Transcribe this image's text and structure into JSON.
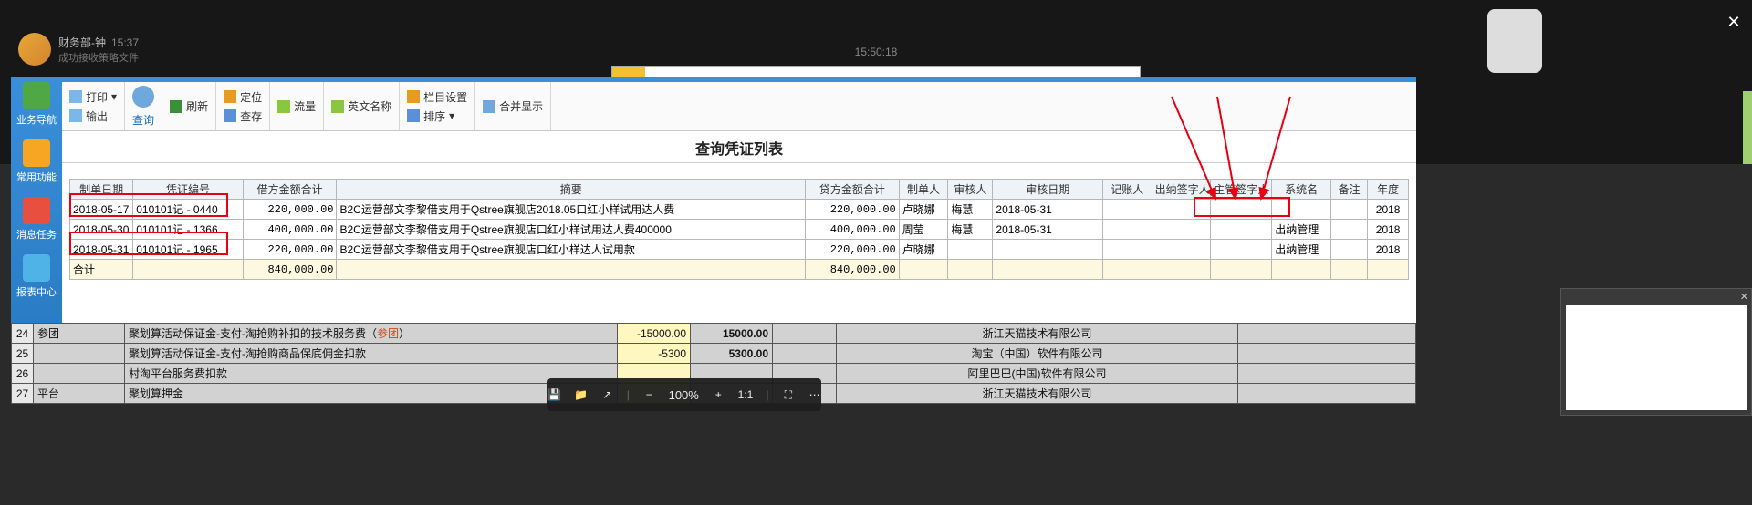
{
  "chat": {
    "name": "财务部-钟",
    "time": "15:37",
    "sub": "成功接收策略文件"
  },
  "clock": "15:50:18",
  "close": "✕",
  "rail": [
    {
      "label": "业务导航"
    },
    {
      "label": "常用功能"
    },
    {
      "label": "消息任务"
    },
    {
      "label": "报表中心"
    }
  ],
  "ribbon": {
    "print": "打印",
    "export": "输出",
    "query": "查询",
    "refresh": "刷新",
    "locate": "定位",
    "savequery": "查存",
    "flow": "流量",
    "english": "英文名称",
    "colsetting": "栏目设置",
    "sort": "排序",
    "merge": "合并显示"
  },
  "grid_title": "查询凭证列表",
  "columns": [
    "制单日期",
    "凭证编号",
    "借方金额合计",
    "摘要",
    "贷方金额合计",
    "制单人",
    "审核人",
    "审核日期",
    "记账人",
    "出纳签字人",
    "主管签字人",
    "系统名",
    "备注",
    "年度"
  ],
  "rows": [
    {
      "date": "2018-05-17",
      "vno": "010101记 - 0440",
      "debit": "220,000.00",
      "summary": "B2C运营部文李黎借支用于Qstree旗舰店2018.05口红小样试用达人费",
      "credit": "220,000.00",
      "maker": "卢晓娜",
      "auditor": "梅慧",
      "adate": "2018-05-31",
      "poster": "",
      "cashier": "",
      "supervisor": "",
      "sysname": "",
      "remark": "",
      "year": "2018"
    },
    {
      "date": "2018-05-30",
      "vno": "010101记 - 1366",
      "debit": "400,000.00",
      "summary": "B2C运营部文李黎借支用于Qstree旗舰店口红小样试用达人费400000",
      "credit": "400,000.00",
      "maker": "周莹",
      "auditor": "梅慧",
      "adate": "2018-05-31",
      "poster": "",
      "cashier": "",
      "supervisor": "",
      "sysname": "出纳管理",
      "remark": "",
      "year": "2018"
    },
    {
      "date": "2018-05-31",
      "vno": "010101记 - 1965",
      "debit": "220,000.00",
      "summary": "B2C运营部文李黎借支用于Qstree旗舰店口红小样达人试用款",
      "credit": "220,000.00",
      "maker": "卢晓娜",
      "auditor": "",
      "adate": "",
      "poster": "",
      "cashier": "",
      "supervisor": "",
      "sysname": "出纳管理",
      "remark": "",
      "year": "2018"
    }
  ],
  "total": {
    "label": "合计",
    "debit": "840,000.00",
    "credit": "840,000.00"
  },
  "bottom_rows": [
    {
      "n": "24",
      "cat": "参团",
      "desc": "聚划算活动保证金-支付-淘抢购补扣的技术服务费（参团）",
      "neg": "-15000.00",
      "amt": "15000.00",
      "company": "浙江天猫技术有限公司"
    },
    {
      "n": "25",
      "cat": "",
      "desc": "聚划算活动保证金-支付-淘抢购商品保底佣金扣款",
      "neg": "-5300",
      "amt": "5300.00",
      "company": "淘宝（中国）软件有限公司"
    },
    {
      "n": "26",
      "cat": "",
      "desc": "村淘平台服务费扣款",
      "neg": "",
      "amt": "",
      "company": "阿里巴巴(中国)软件有限公司"
    },
    {
      "n": "27",
      "cat": "平台",
      "desc": "聚划算押金",
      "neg": "",
      "amt": "",
      "company": "浙江天猫技术有限公司"
    }
  ],
  "viewer": {
    "zoom": "100%"
  }
}
